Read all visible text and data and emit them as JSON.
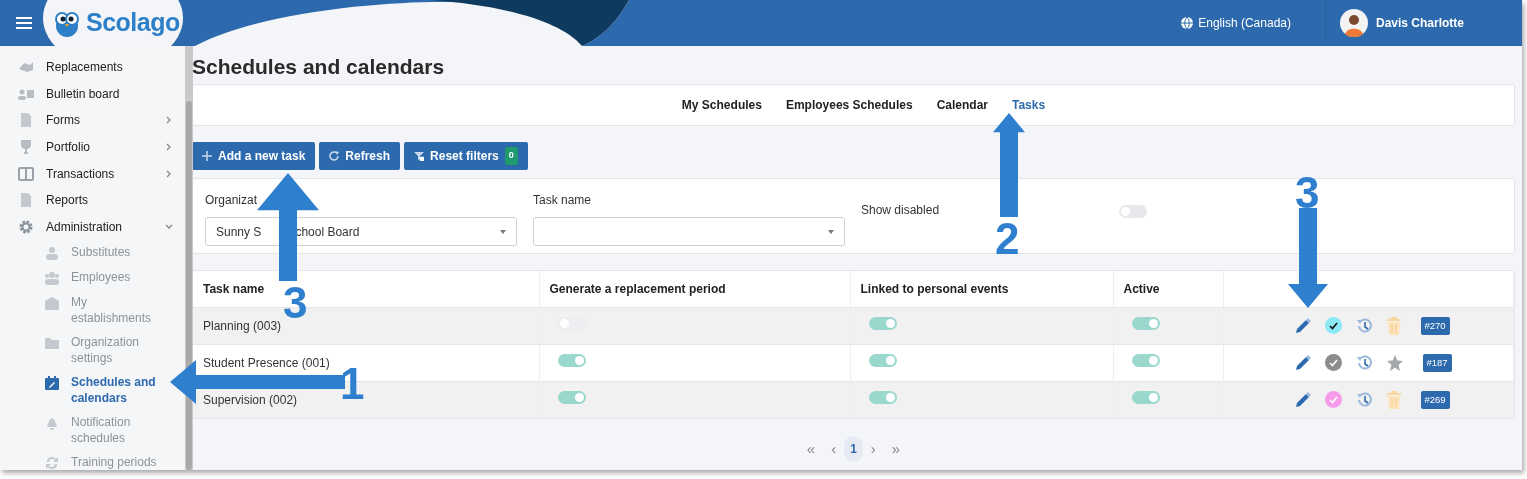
{
  "header": {
    "logo_text": "Scolago",
    "language": "English (Canada)",
    "user": "Davis Charlotte"
  },
  "sidebar": {
    "items": [
      {
        "label": "Replacements",
        "kind": "link"
      },
      {
        "label": "Bulletin board",
        "kind": "link"
      },
      {
        "label": "Forms",
        "kind": "group",
        "expanded": false
      },
      {
        "label": "Portfolio",
        "kind": "group",
        "expanded": false
      },
      {
        "label": "Transactions",
        "kind": "group",
        "expanded": false
      },
      {
        "label": "Reports",
        "kind": "link"
      },
      {
        "label": "Administration",
        "kind": "group",
        "expanded": true,
        "children": [
          {
            "label": "Substitutes",
            "selected": false
          },
          {
            "label": "Employees",
            "selected": false
          },
          {
            "label": "My establishments",
            "selected": false
          },
          {
            "label": "Organization settings",
            "selected": false
          },
          {
            "label": "Schedules and calendars",
            "selected": true
          },
          {
            "label": "Notification schedules",
            "selected": false
          },
          {
            "label": "Training periods",
            "selected": false
          }
        ]
      }
    ]
  },
  "page_title": "Schedules and calendars",
  "tabs": [
    {
      "label": "My Schedules",
      "selected": false
    },
    {
      "label": "Employees Schedules",
      "selected": false
    },
    {
      "label": "Calendar",
      "selected": false
    },
    {
      "label": "Tasks",
      "selected": true
    }
  ],
  "toolbar": [
    {
      "label": "Add a new task",
      "kind": "add"
    },
    {
      "label": "Refresh",
      "kind": "refresh"
    },
    {
      "label": "Reset filters",
      "kind": "reset",
      "count": "0"
    }
  ],
  "filters": {
    "organization": {
      "label": "Organizat",
      "value_parts": [
        "Sunny S",
        "chool Board"
      ]
    },
    "task_name": {
      "label": "Task name"
    },
    "show_disabled": {
      "label": "Show disabled",
      "on": false
    }
  },
  "table": {
    "columns": [
      "Task name",
      "Generate a replacement period",
      "Linked to personal events",
      "Active"
    ],
    "rows": [
      {
        "name": "Planning (003)",
        "generate_replacement": false,
        "linked": true,
        "active": true,
        "color": "#8de8f5",
        "kind": "trash",
        "id": "#270"
      },
      {
        "name": "Student Presence (001)",
        "generate_replacement": true,
        "linked": true,
        "active": true,
        "color": "#8c8c8c",
        "kind": "star",
        "id": "#187"
      },
      {
        "name": "Supervision (002)",
        "generate_replacement": true,
        "linked": true,
        "active": true,
        "color": "#f59be9",
        "kind": "trash",
        "id": "#269"
      }
    ]
  },
  "pagination": {
    "first": "«",
    "previous": "‹",
    "pages": [
      {
        "label": "1",
        "selected": true
      }
    ],
    "next": "›",
    "last": "»"
  },
  "annotations": [
    {
      "number": "1",
      "kind": "left"
    },
    {
      "number": "2",
      "kind": "up"
    },
    {
      "number": "3",
      "kind": "up"
    },
    {
      "number": "3",
      "kind": "down"
    }
  ]
}
